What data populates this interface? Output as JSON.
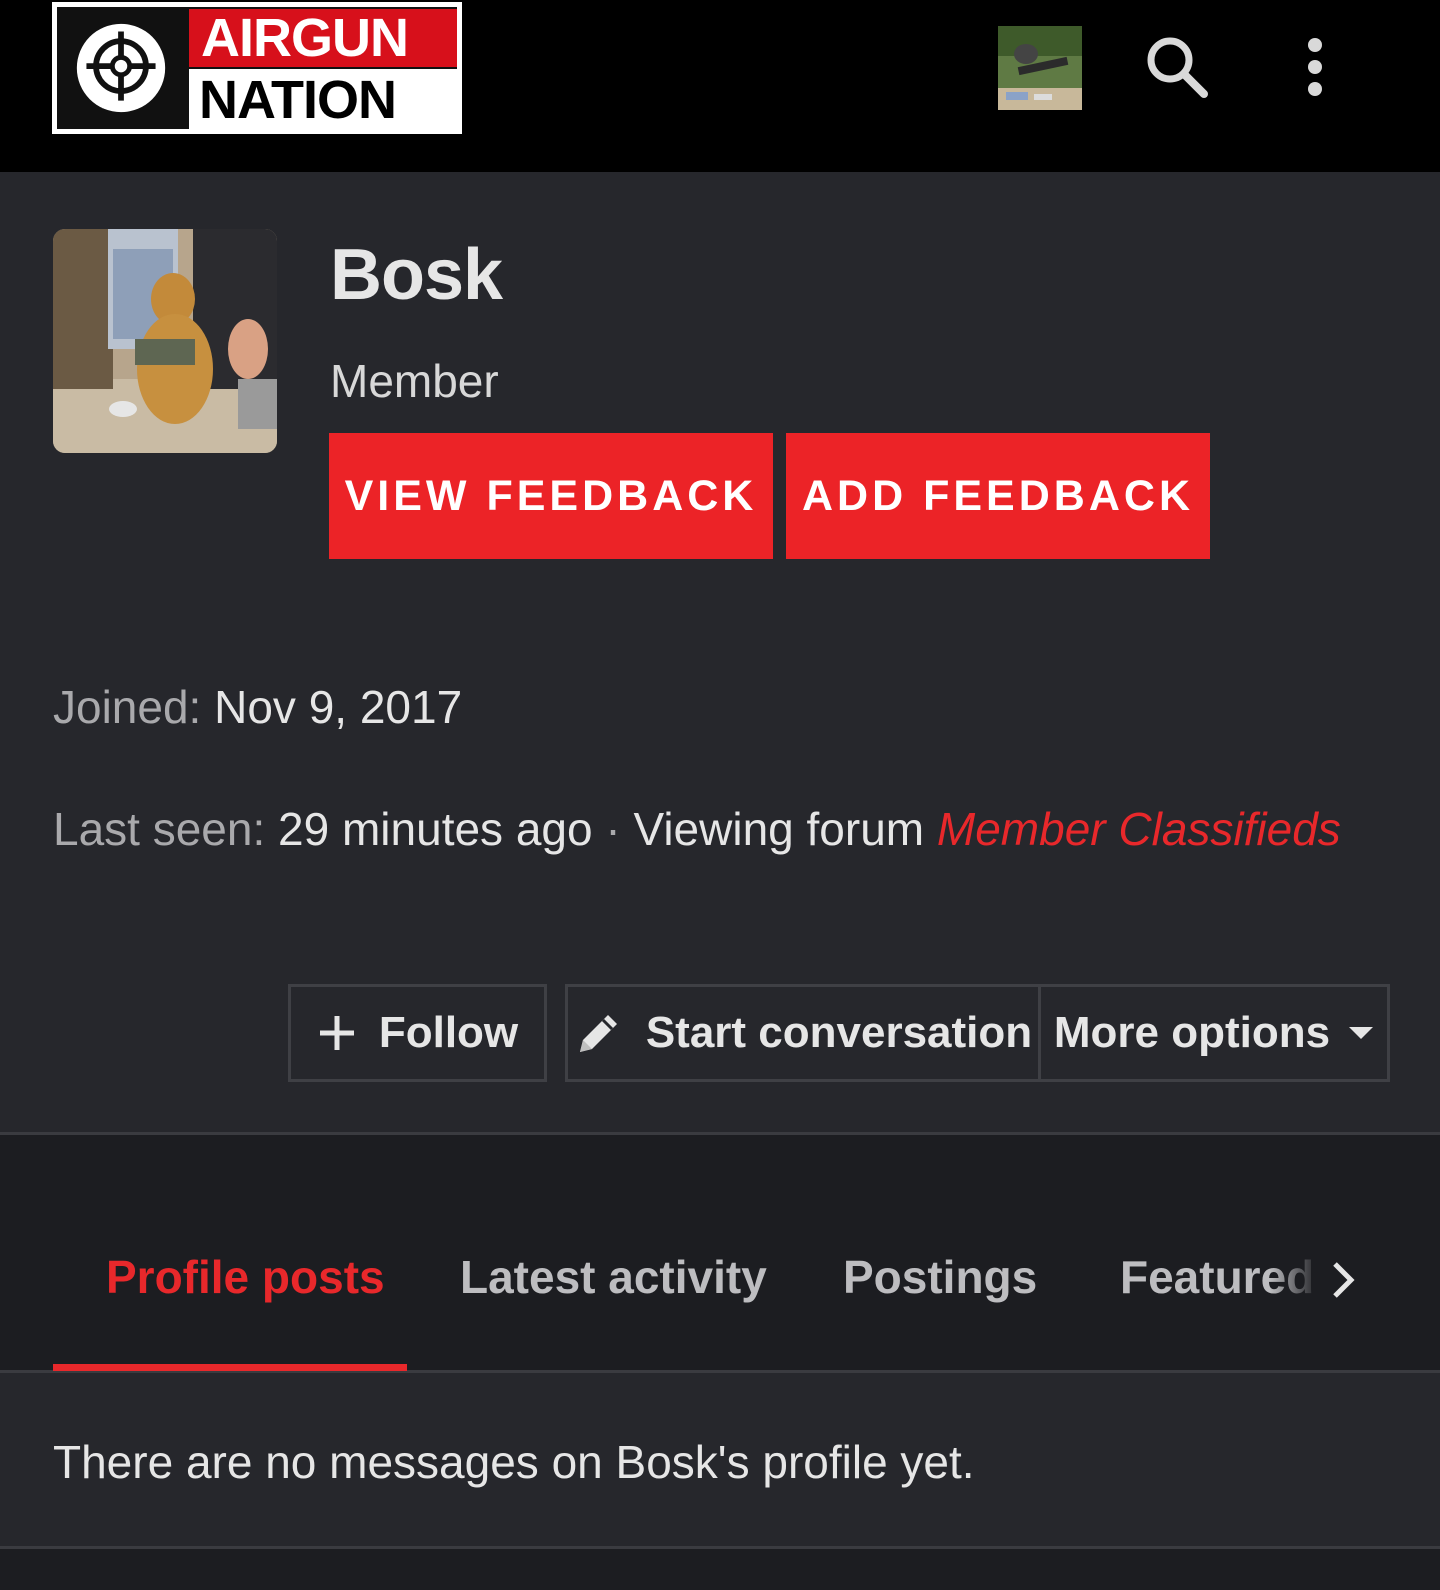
{
  "header": {
    "logo_line1": "AIRGUN",
    "logo_line2": "NATION",
    "icons": [
      "crosshair-icon",
      "search-icon",
      "more-vertical-icon"
    ]
  },
  "profile": {
    "username": "Bosk",
    "role": "Member",
    "view_feedback_label": "VIEW FEEDBACK",
    "add_feedback_label": "ADD FEEDBACK"
  },
  "info": {
    "joined_label": "Joined:",
    "joined_value": "Nov 9, 2017",
    "last_seen_label": "Last seen:",
    "last_seen_value": "29 minutes ago",
    "separator": "·",
    "viewing_text": "Viewing forum",
    "forum_name": "Member Classifieds"
  },
  "actions": {
    "follow_label": "Follow",
    "start_conversation_label": "Start conversation",
    "more_options_label": "More options"
  },
  "tabs": {
    "profile_posts": "Profile posts",
    "latest_activity": "Latest activity",
    "postings": "Postings",
    "featured": "Featured content",
    "active": "Profile posts"
  },
  "messages": {
    "empty_text": "There are no messages on Bosk's profile yet."
  },
  "colors": {
    "accent": "#ec2327",
    "background": "#1c1d21",
    "panel": "#26272c",
    "topbar": "#000000"
  }
}
